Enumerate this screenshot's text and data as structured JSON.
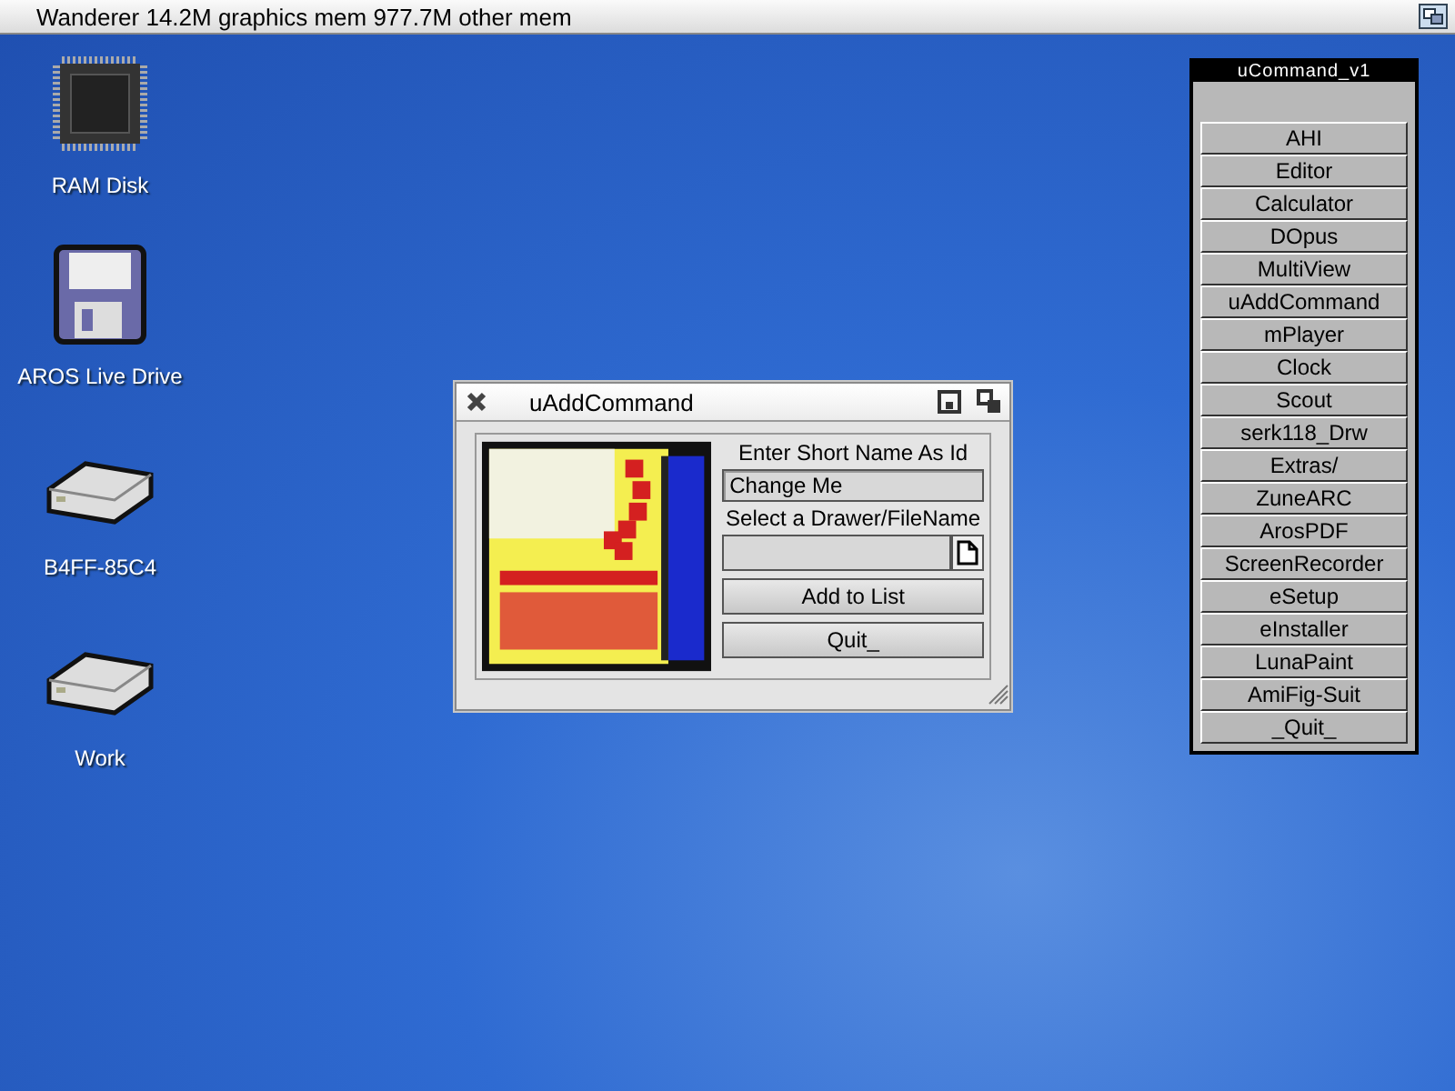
{
  "screen_bar": {
    "title": "Wanderer 14.2M graphics mem 977.7M other mem"
  },
  "desktop_icons": [
    {
      "kind": "chip",
      "label": "RAM Disk"
    },
    {
      "kind": "floppy",
      "label": "AROS Live Drive"
    },
    {
      "kind": "drive",
      "label": "B4FF-85C4"
    },
    {
      "kind": "drive",
      "label": "Work"
    }
  ],
  "add_window": {
    "title": "uAddCommand",
    "name_label": "Enter Short Name As Id",
    "name_value": "Change Me",
    "file_label": "Select a Drawer/FileName",
    "buttons": [
      "Add to List",
      "Quit_"
    ]
  },
  "command_window": {
    "title": "uCommand_v1",
    "buttons": [
      "AHI",
      "Editor",
      "Calculator",
      "DOpus",
      "MultiView",
      "uAddCommand",
      "mPlayer",
      "Clock",
      "Scout",
      "serk118_Drw",
      "Extras/",
      "ZuneARC",
      "ArosPDF",
      "ScreenRecorder",
      "eSetup",
      "eInstaller",
      "LunaPaint",
      "AmiFig-Suit",
      "_Quit_"
    ]
  }
}
